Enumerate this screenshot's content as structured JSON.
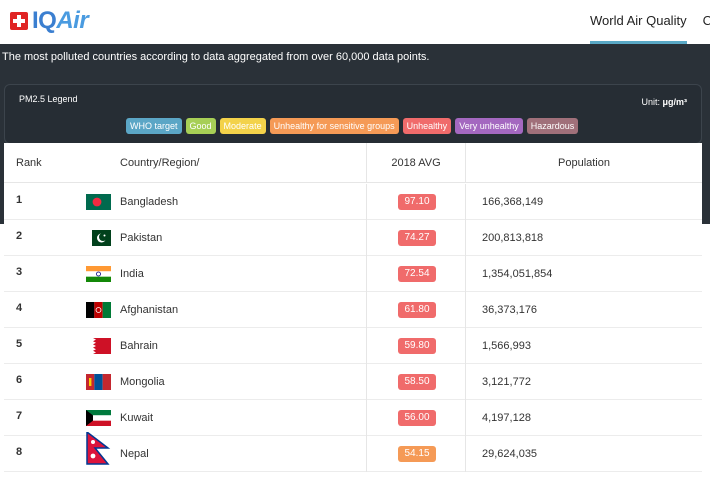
{
  "header": {
    "logo_text_iq": "IQ",
    "logo_text_air": "Air",
    "nav_items": [
      "World Air Quality",
      "Co"
    ]
  },
  "subtitle": "The most polluted countries according to data aggregated from over 60,000 data points.",
  "legend": {
    "title": "PM2.5 Legend",
    "unit_prefix": "Unit: ",
    "unit": "μg/m³",
    "chips": [
      {
        "label": "WHO target",
        "color": "#5ba6c6"
      },
      {
        "label": "Good",
        "color": "#a7cf56"
      },
      {
        "label": "Moderate",
        "color": "#f3d24a"
      },
      {
        "label": "Unhealthy for sensitive groups",
        "color": "#f59a56"
      },
      {
        "label": "Unhealthy",
        "color": "#f06b6b"
      },
      {
        "label": "Very unhealthy",
        "color": "#a468c0"
      },
      {
        "label": "Hazardous",
        "color": "#a0707a"
      }
    ]
  },
  "table": {
    "headers": {
      "rank": "Rank",
      "country": "Country/Region/",
      "avg": "2018 AVG",
      "population": "Population"
    },
    "rows": [
      {
        "rank": "1",
        "country": "Bangladesh",
        "avg": "97.10",
        "population": "166,368,149",
        "badge_color": "#f06b6b"
      },
      {
        "rank": "2",
        "country": "Pakistan",
        "avg": "74.27",
        "population": "200,813,818",
        "badge_color": "#f06b6b"
      },
      {
        "rank": "3",
        "country": "India",
        "avg": "72.54",
        "population": "1,354,051,854",
        "badge_color": "#f06b6b"
      },
      {
        "rank": "4",
        "country": "Afghanistan",
        "avg": "61.80",
        "population": "36,373,176",
        "badge_color": "#f06b6b"
      },
      {
        "rank": "5",
        "country": "Bahrain",
        "avg": "59.80",
        "population": "1,566,993",
        "badge_color": "#f06b6b"
      },
      {
        "rank": "6",
        "country": "Mongolia",
        "avg": "58.50",
        "population": "3,121,772",
        "badge_color": "#f06b6b"
      },
      {
        "rank": "7",
        "country": "Kuwait",
        "avg": "56.00",
        "population": "4,197,128",
        "badge_color": "#f06b6b"
      },
      {
        "rank": "8",
        "country": "Nepal",
        "avg": "54.15",
        "population": "29,624,035",
        "badge_color": "#f59a56"
      }
    ]
  }
}
